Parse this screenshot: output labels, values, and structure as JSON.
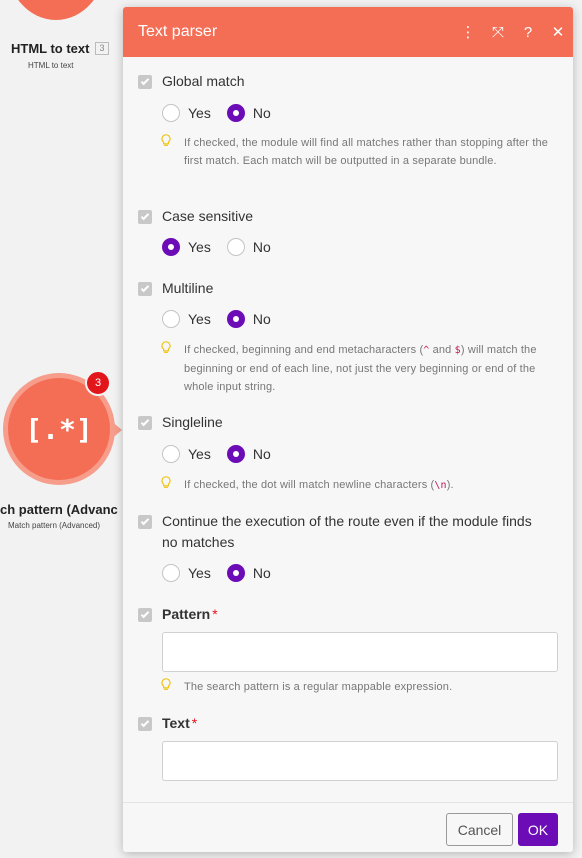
{
  "canvas": {
    "top_module": {
      "title": "HTML to text",
      "count": "3",
      "subtitle": "HTML to text"
    },
    "mid_module": {
      "icon_glyph": "[.*]",
      "badge": "3",
      "title": "ch pattern (Advanc",
      "subtitle": "Match pattern (Advanced)"
    },
    "accent_color": "#f46e56"
  },
  "panel": {
    "title": "Text parser",
    "header_icons": [
      "more-vertical-icon",
      "expand-icon",
      "help-icon",
      "close-icon"
    ],
    "header_glyphs": {
      "more": "⋮",
      "expand": "⤧",
      "help": "?",
      "close": "✕"
    },
    "fields": {
      "global_match": {
        "label": "Global match",
        "options": [
          "Yes",
          "No"
        ],
        "selected": "No",
        "hint": "If checked, the module will find all matches rather than stopping after the first match. Each match will be outputted in a separate bundle."
      },
      "case_sensitive": {
        "label": "Case sensitive",
        "options": [
          "Yes",
          "No"
        ],
        "selected": "Yes"
      },
      "multiline": {
        "label": "Multiline",
        "options": [
          "Yes",
          "No"
        ],
        "selected": "No",
        "hint_pre": "If checked, beginning and end metacharacters (",
        "hint_code1": "^",
        "hint_mid": " and ",
        "hint_code2": "$",
        "hint_post": ") will match the beginning or end of each line, not just the very beginning or end of the whole input string."
      },
      "singleline": {
        "label": "Singleline",
        "options": [
          "Yes",
          "No"
        ],
        "selected": "No",
        "hint_pre": "If checked, the dot will match newline characters (",
        "hint_code": "\\n",
        "hint_post": ")."
      },
      "continue_execution": {
        "label": "Continue the execution of the route even if the module finds no matches",
        "options": [
          "Yes",
          "No"
        ],
        "selected": "No"
      },
      "pattern": {
        "label": "Pattern",
        "required_mark": "*",
        "value": "",
        "hint": "The search pattern is a regular mappable expression."
      },
      "text": {
        "label": "Text",
        "required_mark": "*",
        "value": ""
      }
    },
    "footer": {
      "cancel_label": "Cancel",
      "ok_label": "OK"
    },
    "colors": {
      "primary": "#6c0cb7",
      "header": "#f46e56",
      "required": "#e2151b",
      "hint_bulb": "#f0c419"
    }
  }
}
